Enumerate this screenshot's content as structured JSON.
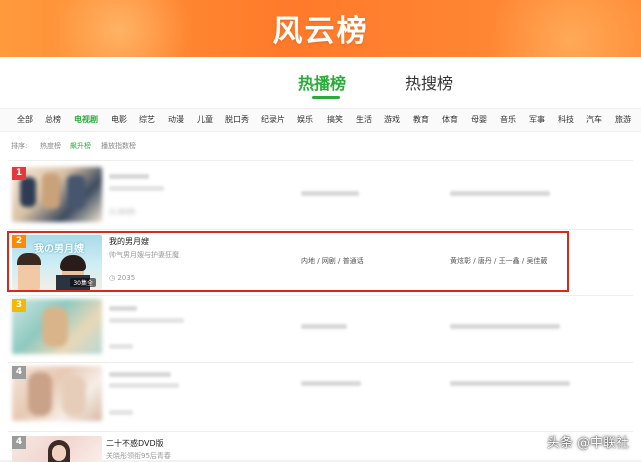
{
  "banner": {
    "title": "风云榜"
  },
  "main_tabs": [
    {
      "label": "热播榜",
      "active": true
    },
    {
      "label": "热搜榜",
      "active": false
    }
  ],
  "categories": [
    "全部",
    "总榜",
    "电视剧",
    "电影",
    "综艺",
    "动漫",
    "儿童",
    "脱口秀",
    "纪录片",
    "娱乐",
    "搞笑",
    "生活",
    "游戏",
    "教育",
    "体育",
    "母婴",
    "音乐",
    "军事",
    "科技",
    "汽车",
    "旅游"
  ],
  "active_category": "电视剧",
  "sort": {
    "label": "排序:",
    "options": [
      "热度榜",
      "飙升榜",
      "播放指数榜"
    ],
    "active": "飙升榜"
  },
  "rows": [
    {
      "rank": "1",
      "title": "",
      "subtitle": "",
      "views": "2035",
      "tags": [],
      "cast": [],
      "blurred": true
    },
    {
      "rank": "2",
      "title": "我的男月嫂",
      "subtitle": "帅气男月嫂与护妻狂魔",
      "views": "2035",
      "tags": [
        "内地",
        "网剧",
        "普通话"
      ],
      "cast": [
        "黄炫彰",
        "唐丹",
        "王一鑫",
        "吴佳葳"
      ],
      "badge": "30集全",
      "blurred": false
    },
    {
      "rank": "3",
      "title": "",
      "subtitle": "",
      "views": "",
      "tags": [],
      "cast": [],
      "blurred": true
    },
    {
      "rank": "4",
      "title": "",
      "subtitle": "",
      "views": "",
      "tags": [],
      "cast": [],
      "blurred": true
    },
    {
      "rank": "4",
      "title": "二十不惑DVD版",
      "subtitle": "关晓彤领衔95后青春",
      "views": "",
      "tags": [],
      "cast": [],
      "blurred": false
    }
  ],
  "watermark": "头条 @中联社",
  "colors": {
    "accent": "#2bab3b",
    "banner": "#ff8a3a",
    "highlight": "#d9291c"
  }
}
